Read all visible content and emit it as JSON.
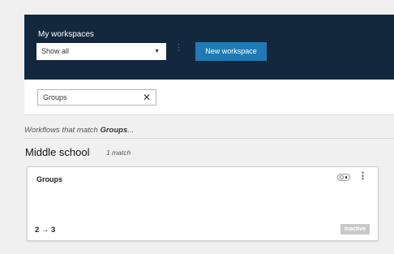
{
  "header": {
    "title": "My workspaces",
    "filter_select_value": "Show all",
    "new_workspace_label": "New workspace"
  },
  "search": {
    "value": "Groups"
  },
  "results": {
    "prefix": "Workflows that match ",
    "term": "Groups",
    "suffix": "..."
  },
  "section": {
    "title": "Middle school",
    "count": "1 match"
  },
  "card": {
    "title": "Groups",
    "steps": "2 → 3",
    "status": "Inactive"
  },
  "colors": {
    "header_bg": "#14283d",
    "accent": "#1f7ab5",
    "inactive_badge": "#c9c9c9"
  },
  "icons": {
    "select_caret": "caret-down-icon",
    "header_more": "kebab-icon",
    "search_clear": "close-icon",
    "card_toggle": "toggle-icon",
    "card_more": "kebab-icon"
  }
}
